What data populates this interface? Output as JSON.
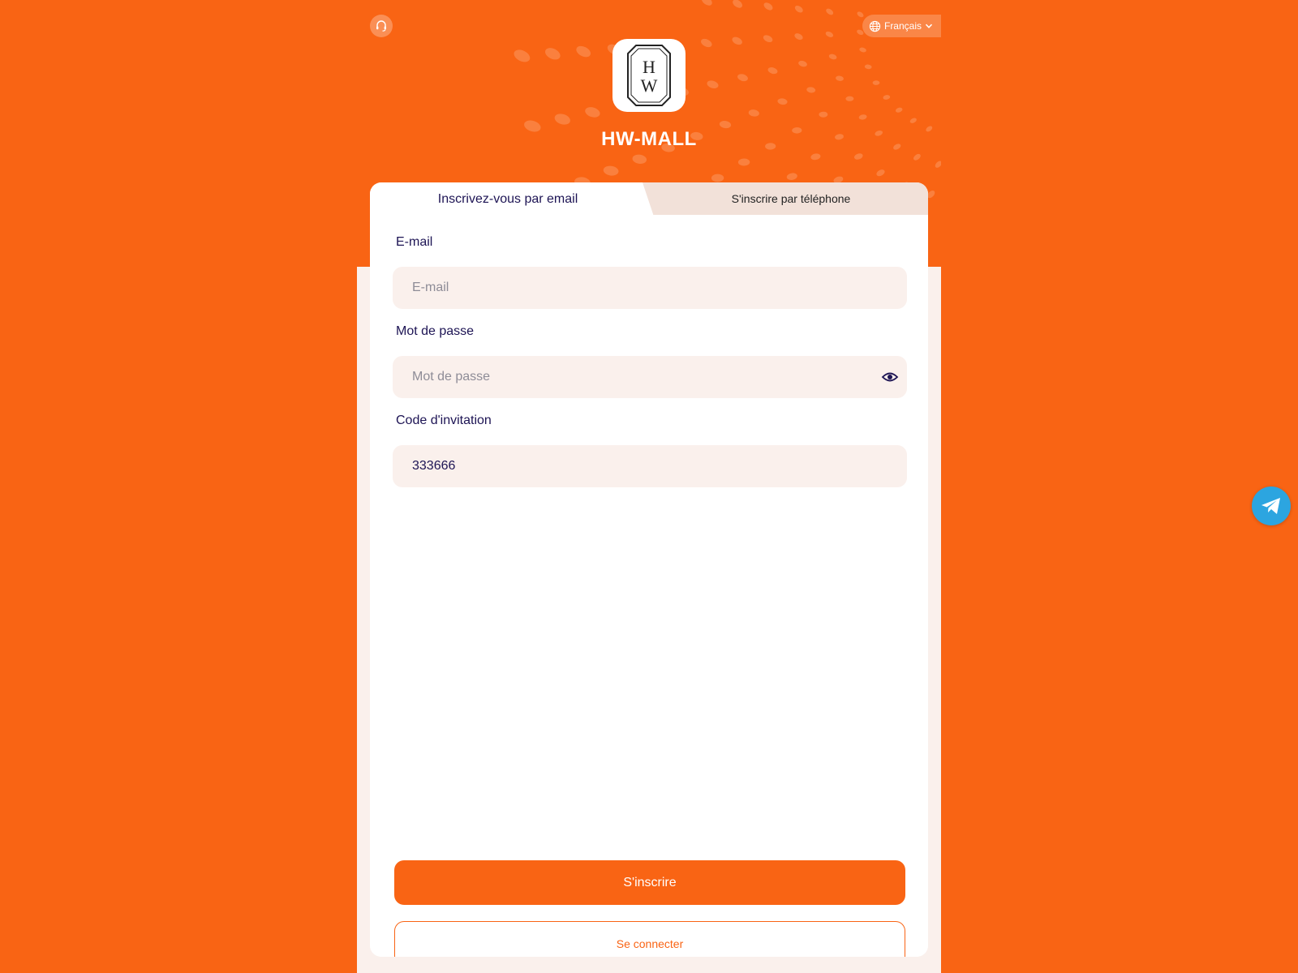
{
  "app": {
    "brand_name": "HW-MALL",
    "logo_letters": "HW"
  },
  "header": {
    "language_label": "Français"
  },
  "tabs": [
    {
      "label": "Inscrivez-vous par email",
      "active": true
    },
    {
      "label": "S'inscrire par téléphone",
      "active": false
    }
  ],
  "form": {
    "email": {
      "label": "E-mail",
      "placeholder": "E-mail",
      "value": ""
    },
    "password": {
      "label": "Mot de passe",
      "placeholder": "Mot de passe",
      "value": ""
    },
    "invite": {
      "label": "Code d'invitation",
      "value": "333666"
    }
  },
  "actions": {
    "register": "S'inscrire",
    "login": "Se connecter"
  },
  "icons": {
    "support": "headset-icon",
    "language": "globe-icon",
    "dropdown": "chevron-down-icon",
    "password_toggle": "eye-icon",
    "floating": "telegram-icon"
  },
  "colors": {
    "accent": "#F96414",
    "text_dark": "#1D1454",
    "field_bg": "#FAF0EC",
    "telegram": "#2CA5E0"
  }
}
